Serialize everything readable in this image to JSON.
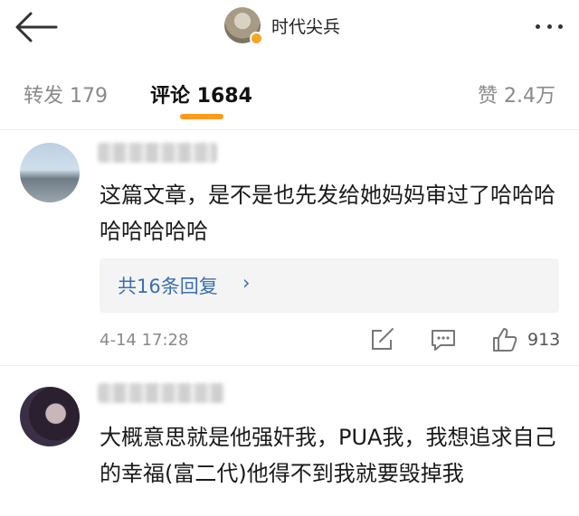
{
  "header": {
    "title": "时代尖兵",
    "icons": {
      "back": "back-arrow-icon",
      "more": "more-dots-icon",
      "verified": "verified-badge-icon"
    }
  },
  "tabs": {
    "repost": "转发 179",
    "comment": "评论 1684",
    "like": "赞 2.4万",
    "active": "comment",
    "accent_color": "#ff9a1c"
  },
  "comments": [
    {
      "text": "这篇文章，是不是也先发给她妈妈审过了哈哈哈哈哈哈哈哈",
      "replies_label": "共16条回复",
      "replies_chevron": "›",
      "timestamp": "4-14 17:28",
      "like_count": "913",
      "icons": {
        "share": "share-edit-icon",
        "comment": "comment-bubble-icon",
        "like": "thumbs-up-icon"
      }
    },
    {
      "text": "大概意思就是他强奸我，PUA我，我想追求自己的幸福(富二代)他得不到我就要毁掉我"
    }
  ],
  "colors": {
    "link": "#3a6fb0",
    "muted": "#8a8a8a",
    "reply_bg": "#f4f4f4"
  }
}
